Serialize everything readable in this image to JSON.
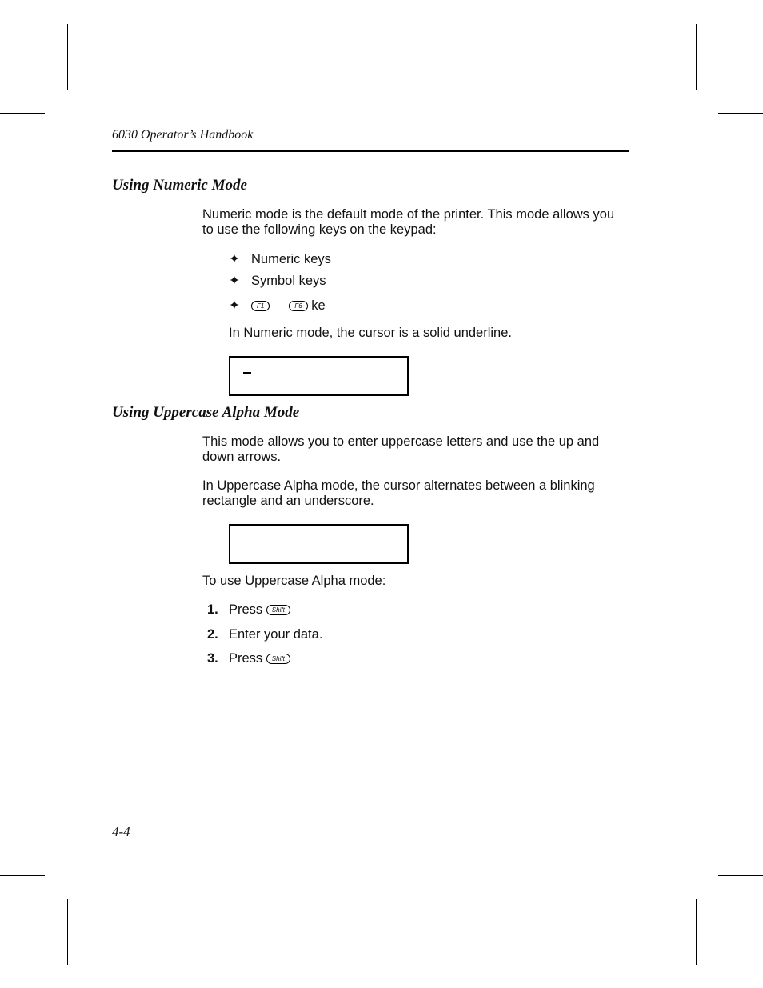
{
  "header": {
    "title": "6030 Operator’s Handbook"
  },
  "sections": [
    {
      "heading": "Using Numeric Mode",
      "intro": "Numeric mode is the default mode of the printer.  This mode allows you to use the following keys on the keypad:",
      "bullets": [
        {
          "text": "Numeric keys"
        },
        {
          "text": "Symbol keys"
        },
        {
          "key1": "F1",
          "key2": "F6",
          "text": "ke"
        }
      ],
      "note": "In Numeric mode, the cursor is a solid underline.",
      "display": {
        "cursor": "solid-underline"
      }
    },
    {
      "heading": "Using Uppercase Alpha Mode",
      "intro": "This mode allows you to enter uppercase letters and use the up and down arrows.",
      "note": "In Uppercase Alpha mode, the cursor alternates between a blinking rectangle and an underscore.",
      "lead": "To use Uppercase Alpha mode:",
      "steps": [
        {
          "num": "1.",
          "text": "Press",
          "key": "Shift"
        },
        {
          "num": "2.",
          "text": "Enter your data."
        },
        {
          "num": "3.",
          "text": "Press",
          "key": "Shift"
        }
      ]
    }
  ],
  "footer": {
    "page": "4-4"
  },
  "icons": {
    "bullet": "✦"
  }
}
